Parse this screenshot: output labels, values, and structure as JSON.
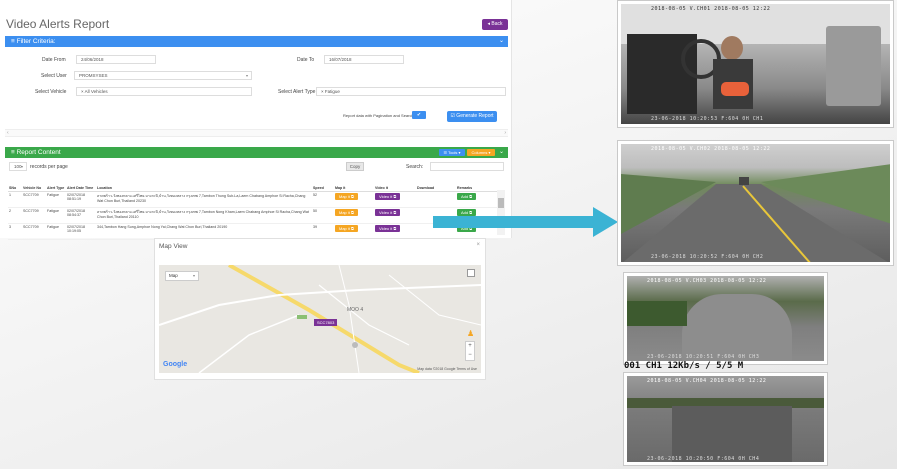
{
  "page": {
    "title": "Video Alerts Report",
    "back_label": "◂ Back"
  },
  "filter": {
    "header": "≡ Filter Criteria:",
    "date_from_label": "Date From",
    "date_from_value": "24/06/2018",
    "date_to_label": "Date To",
    "date_to_value": "16/07/2018",
    "user_label": "Select User",
    "user_value": "PROMSYSES",
    "vehicle_label": "Select Vehicle",
    "vehicle_value": "× All Vehicles",
    "alert_type_label": "Select Alert Type",
    "alert_type_value": "× Fatigue",
    "pagination_label": "Report data with Pagination and Search",
    "generate_label": "☑ Generate Report"
  },
  "report": {
    "header": "≡ Report Content",
    "tools_label": "☰ Tools ▾",
    "columns_label": "Columns ▾",
    "records_value": "100",
    "records_label": "records per page",
    "copy_label": "Copy",
    "search_label": "Search:",
    "columns": [
      "SNo",
      "Vehicle No",
      "Alert Type",
      "Alert Date Time",
      "Location",
      "Speed",
      "Map it",
      "Video it",
      "Download",
      "Remarks"
    ],
    "rows": [
      [
        "1",
        "SCC7709",
        "Fatigue",
        "02/07/2018 08:51:19",
        "ลาดพร้าว-วังทองหลาง-เสรีไทย-บางกะปิ,บ้าน,วังทองหลาง กรุงเทพ 7,Tambon Thung Sub-La,Laem Chabang Amphoe Si Racha,Chang Wat Chon Buri,Thailand 20230",
        "52",
        "Map it ⧉",
        "Video it ⧉",
        "",
        "Add ⧉"
      ],
      [
        "2",
        "SCC7709",
        "Fatigue",
        "02/07/2018 08:54:37",
        "ลาดพร้าว-วังทองหลาง-เสรีไทย-บางกะปิ,บ้าน,วังทองหลาง กรุงเทพ 7,Tambon Nong Kham,Laem Chabang Amphoe Si Racha,Chang Wat Chon Buri,Thailand 20110",
        "50",
        "Map it ⧉",
        "Video it ⧉",
        "",
        "Add ⧉"
      ],
      [
        "3",
        "SCC7709",
        "Fatigue",
        "02/07/2018 10:19:05",
        "344,Tambon Hang Sung,Amphoe Nong Yai,Chang Wat Chon Buri,Thailand 20190",
        "39",
        "Map it ⧉",
        "Video it ⧉",
        "",
        "Add ⧉"
      ]
    ]
  },
  "map": {
    "title": "Map View",
    "close": "×",
    "type_select": "Map",
    "marker_label": "SCC7803",
    "place_label": "MOO 4",
    "zoom_in": "+",
    "zoom_out": "−",
    "google": "Google",
    "attribution": "Map data ©2018 Google   Terms of Use"
  },
  "cameras": [
    {
      "header": "2018-08-05  V.CH01  2018-08-05 12:22",
      "timestamp": "23-06-2018 10:20:53 F:604 0H  CH1"
    },
    {
      "header": "2018-08-05  V.CH02  2018-08-05 12:22",
      "timestamp": "23-06-2018 10:20:52 F:604 0H  CH2"
    },
    {
      "header": "2018-08-05  V.CH03  2018-08-05 12:22",
      "timestamp": "23-06-2018 10:20:51 F:604 0H  CH3"
    },
    {
      "header": "2018-08-05  V.CH04  2018-08-05 12:22",
      "timestamp": "23-06-2018 10:20:50 F:604 0H  CH4",
      "overlay": "001  CH1  12Kb/s / 5/5 M"
    }
  ],
  "colors": {
    "primary": "#3c8ff0",
    "success": "#3aa84a",
    "purple": "#7a3296",
    "warning": "#f5a623",
    "arrow": "#3bb3d4"
  }
}
